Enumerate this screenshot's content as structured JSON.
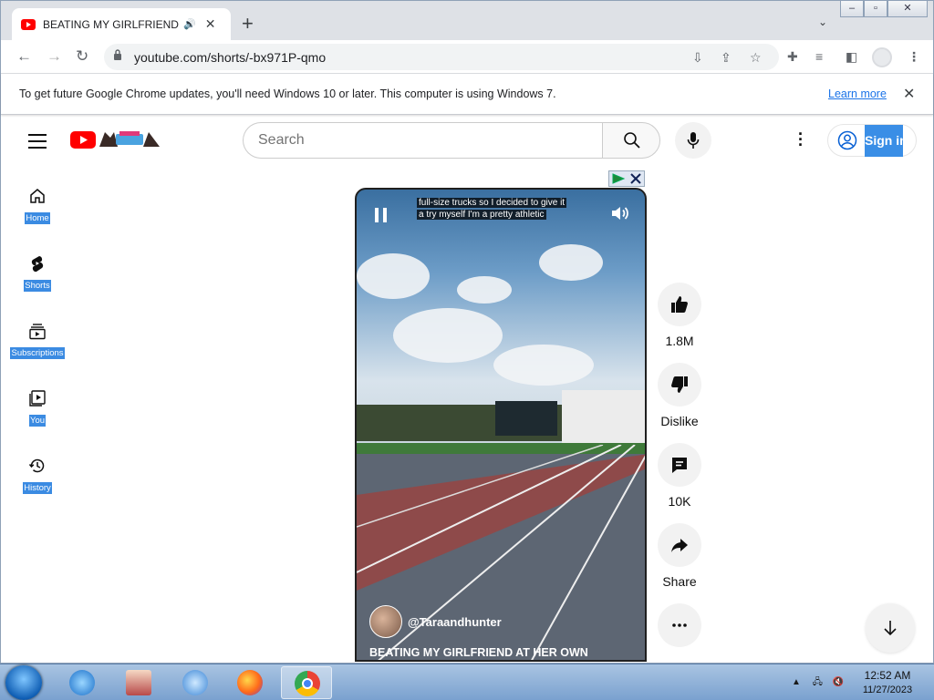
{
  "browser": {
    "tab_title": "BEATING MY GIRLFRIEND AT",
    "url": "youtube.com/shorts/-bx971P-qmo",
    "infobar_message": "To get future Google Chrome updates, you'll need Windows 10 or later. This computer is using Windows 7.",
    "infobar_link": "Learn more"
  },
  "masthead": {
    "search_placeholder": "Search",
    "signin_label": "Sign in"
  },
  "sidebar": {
    "items": [
      {
        "label": "Home",
        "icon": "home-icon"
      },
      {
        "label": "Shorts",
        "icon": "shorts-icon"
      },
      {
        "label": "Subscriptions",
        "icon": "subscriptions-icon"
      },
      {
        "label": "You",
        "icon": "you-icon"
      },
      {
        "label": "History",
        "icon": "history-icon"
      }
    ]
  },
  "short": {
    "caption_line1": "full-size trucks so I decided to give it",
    "caption_line2": "a try myself I'm a pretty athletic",
    "channel": "@Taraandhunter",
    "title": "BEATING MY GIRLFRIEND AT HER OWN"
  },
  "actions": {
    "likes": "1.8M",
    "dislike": "Dislike",
    "comments": "10K",
    "share": "Share"
  },
  "taskbar": {
    "time": "12:52 AM",
    "date": "11/27/2023"
  },
  "colors": {
    "youtube_red": "#ff0000",
    "selection_blue": "#3b8be2",
    "link_blue": "#1a73e8"
  }
}
